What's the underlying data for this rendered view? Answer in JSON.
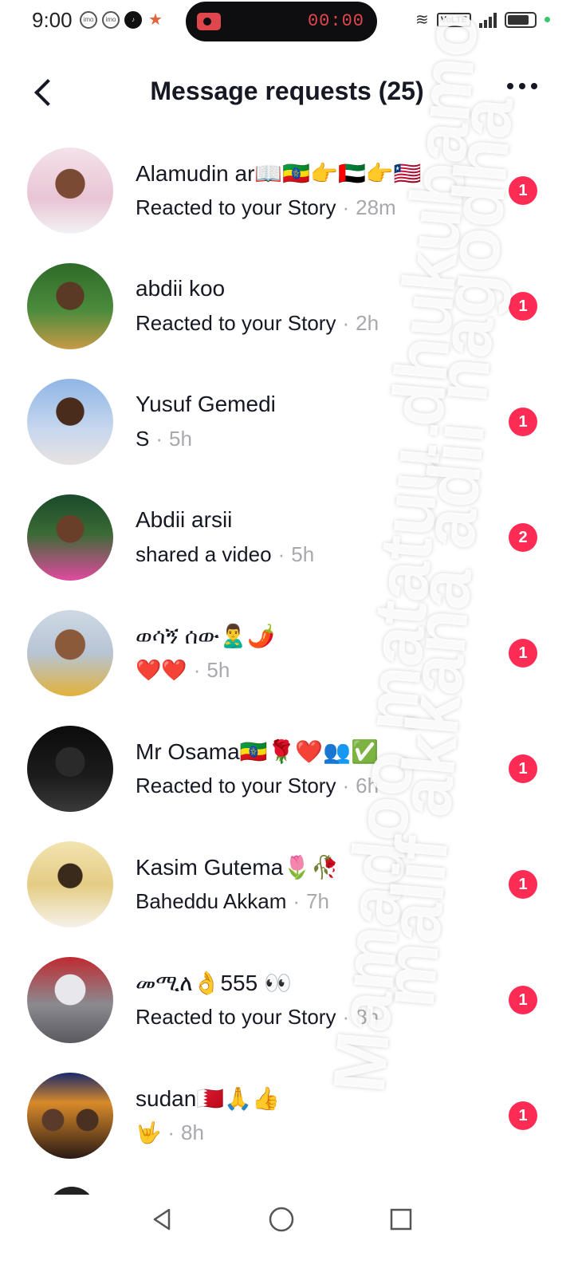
{
  "status_bar": {
    "time": "9:00",
    "recording_time": "00:00",
    "network": "VoLTE",
    "app_icons": [
      "imo-icon",
      "imo-icon",
      "tiktok-icon",
      "star-icon"
    ]
  },
  "header": {
    "title": "Message requests (25)"
  },
  "requests": [
    {
      "name": "Alamudin ar📖🇪🇹👉🇦🇪👉🇱🇷",
      "message": "Reacted to your Story",
      "time": "28m",
      "badge": "1"
    },
    {
      "name": "abdii koo",
      "message": "Reacted to your Story",
      "time": "2h",
      "badge": "1"
    },
    {
      "name": "Yusuf Gemedi",
      "message": "S",
      "time": "5h",
      "badge": "1"
    },
    {
      "name": "Abdii arsii",
      "message": "shared a video",
      "time": "5h",
      "badge": "2"
    },
    {
      "name": "ወሳኝ ሰው🙎‍♂️🌶️",
      "message": "❤️❤️",
      "time": "5h",
      "badge": "1"
    },
    {
      "name": "Mr Osama🇪🇹🌹❤️👥✅",
      "message": "Reacted to your Story",
      "time": "6h",
      "badge": "1"
    },
    {
      "name": "Kasim Gutema🌷🥀",
      "message": "Baheddu Akkam",
      "time": "7h",
      "badge": "1"
    },
    {
      "name": "መሚለ👌555 👀",
      "message": "Reacted to your Story",
      "time": "8h",
      "badge": "1"
    },
    {
      "name": "sudan🇧🇭🙏👍",
      "message": "🤟",
      "time": "8h",
      "badge": "1"
    }
  ],
  "watermark": {
    "line1": "Mamadoo matatuu dhukubamo",
    "line2": "malif akkana adii nagodha"
  },
  "separator": "·"
}
